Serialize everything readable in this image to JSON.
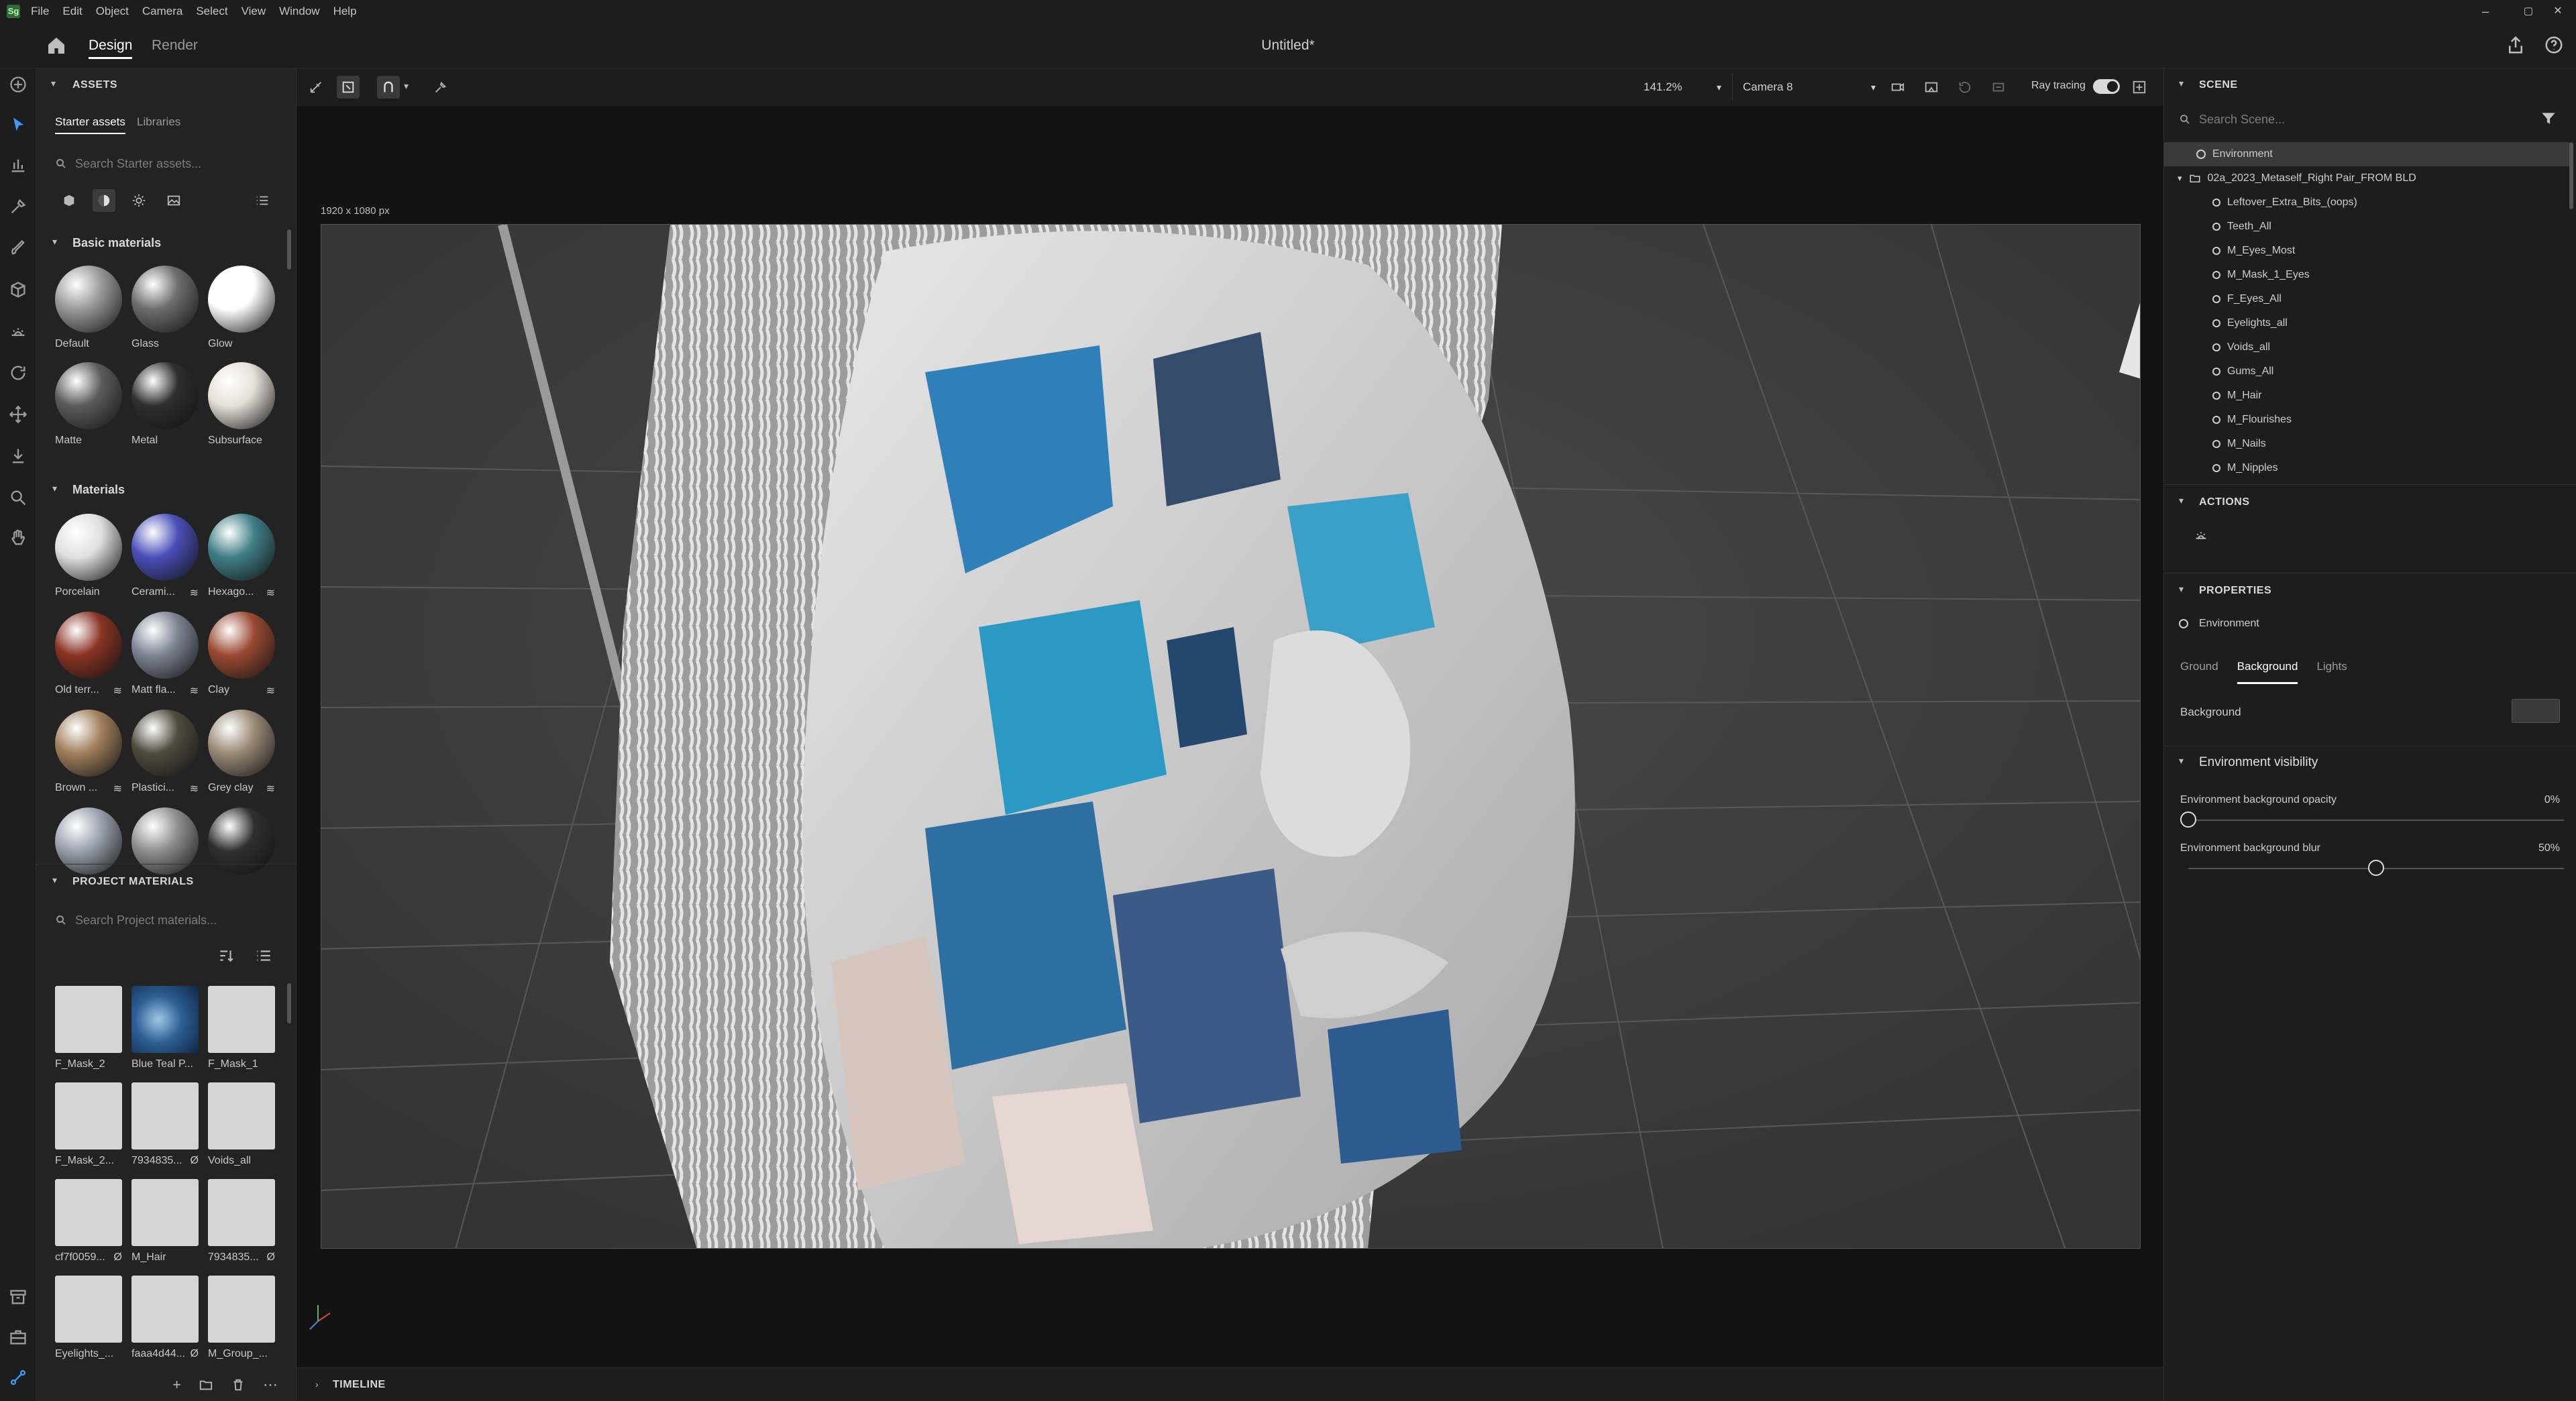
{
  "menubar": {
    "items": [
      "File",
      "Edit",
      "Object",
      "Camera",
      "Select",
      "View",
      "Window",
      "Help"
    ],
    "window_buttons": [
      "–",
      "▢",
      "✕"
    ]
  },
  "topbar": {
    "tabs": [
      "Design",
      "Render"
    ],
    "title": "Untitled*"
  },
  "assets": {
    "header": "ASSETS",
    "tabs": [
      "Starter assets",
      "Libraries"
    ],
    "search_placeholder": "Search Starter assets...",
    "basic": {
      "title": "Basic materials",
      "items": [
        {
          "label": "Default",
          "swatch": "#9a9a9a"
        },
        {
          "label": "Glass",
          "swatch": "#6d6d6d"
        },
        {
          "label": "Glow",
          "swatch": "#ffffff"
        },
        {
          "label": "Matte",
          "swatch": "#5c5c5c"
        },
        {
          "label": "Metal",
          "swatch": "#2e2e2e"
        },
        {
          "label": "Subsurface",
          "swatch": "#e6e0d8"
        }
      ]
    },
    "materials": {
      "title": "Materials",
      "items": [
        {
          "label": "Porcelain",
          "swatch": "#e0e0e0",
          "badge": ""
        },
        {
          "label": "Cerami...",
          "swatch": "#4a4fb8",
          "badge": "≋"
        },
        {
          "label": "Hexago...",
          "swatch": "#3f7f86",
          "badge": "≋"
        },
        {
          "label": "Old terr...",
          "swatch": "#8a3324",
          "badge": "≋"
        },
        {
          "label": "Matt fla...",
          "swatch": "#7d8494",
          "badge": "≋"
        },
        {
          "label": "Clay",
          "swatch": "#9a4a33",
          "badge": "≋"
        },
        {
          "label": "Brown ...",
          "swatch": "#a07f5c",
          "badge": "≋"
        },
        {
          "label": "Plastici...",
          "swatch": "#4e4c3e",
          "badge": "≋"
        },
        {
          "label": "Grey clay",
          "swatch": "#9b8a77",
          "badge": "≋"
        },
        {
          "label": "",
          "swatch": "#9aa2ad",
          "badge": ""
        },
        {
          "label": "",
          "swatch": "#8f8f8f",
          "badge": ""
        },
        {
          "label": "",
          "swatch": "#2f2f2f",
          "badge": ""
        }
      ]
    },
    "project": {
      "title": "PROJECT MATERIALS",
      "search_placeholder": "Search Project materials...",
      "items": [
        {
          "label": "F_Mask_2",
          "badge": ""
        },
        {
          "label": "Blue Teal P...",
          "badge": ""
        },
        {
          "label": "F_Mask_1",
          "badge": ""
        },
        {
          "label": "F_Mask_2...",
          "badge": ""
        },
        {
          "label": "7934835...",
          "badge": "Ø"
        },
        {
          "label": "Voids_all",
          "badge": ""
        },
        {
          "label": "cf7f0059...",
          "badge": "Ø"
        },
        {
          "label": "M_Hair",
          "badge": ""
        },
        {
          "label": "7934835...",
          "badge": "Ø"
        },
        {
          "label": "Eyelights_...",
          "badge": ""
        },
        {
          "label": "faaa4d44...",
          "badge": "Ø"
        },
        {
          "label": "M_Group_...",
          "badge": ""
        }
      ]
    },
    "footer_icons": [
      "+",
      "folder",
      "trash",
      "more"
    ]
  },
  "viewport": {
    "zoom": "141.2%",
    "camera": "Camera 8",
    "ray_tracing_label": "Ray tracing",
    "ray_tracing_on": true,
    "resolution": "1920 x 1080 px"
  },
  "timeline": {
    "label": "TIMELINE"
  },
  "scene": {
    "header": "SCENE",
    "search_placeholder": "Search Scene...",
    "environment": "Environment",
    "group": "02a_2023_Metaself_Right Pair_FROM BLD",
    "children": [
      "Leftover_Extra_Bits_(oops)",
      "Teeth_All",
      "M_Eyes_Most",
      "M_Mask_1_Eyes",
      "F_Eyes_All",
      "Eyelights_all",
      "Voids_all",
      "Gums_All",
      "M_Hair",
      "M_Flourishes",
      "M_Nails",
      "M_Nipples"
    ]
  },
  "actions": {
    "header": "ACTIONS"
  },
  "properties": {
    "header": "PROPERTIES",
    "object": "Environment",
    "tabs": [
      "Ground",
      "Background",
      "Lights"
    ],
    "active_tab": "Background",
    "background_label": "Background",
    "background_color": "#3a3a3a",
    "visibility_title": "Environment visibility",
    "opacity_label": "Environment background opacity",
    "opacity_value": "0%",
    "opacity_fraction": 0.0,
    "blur_label": "Environment background blur",
    "blur_value": "50%",
    "blur_fraction": 0.5
  },
  "colors": {
    "accent": "#ffffff",
    "panel": "#232323",
    "viewport_bg": "#3d3d3d"
  }
}
